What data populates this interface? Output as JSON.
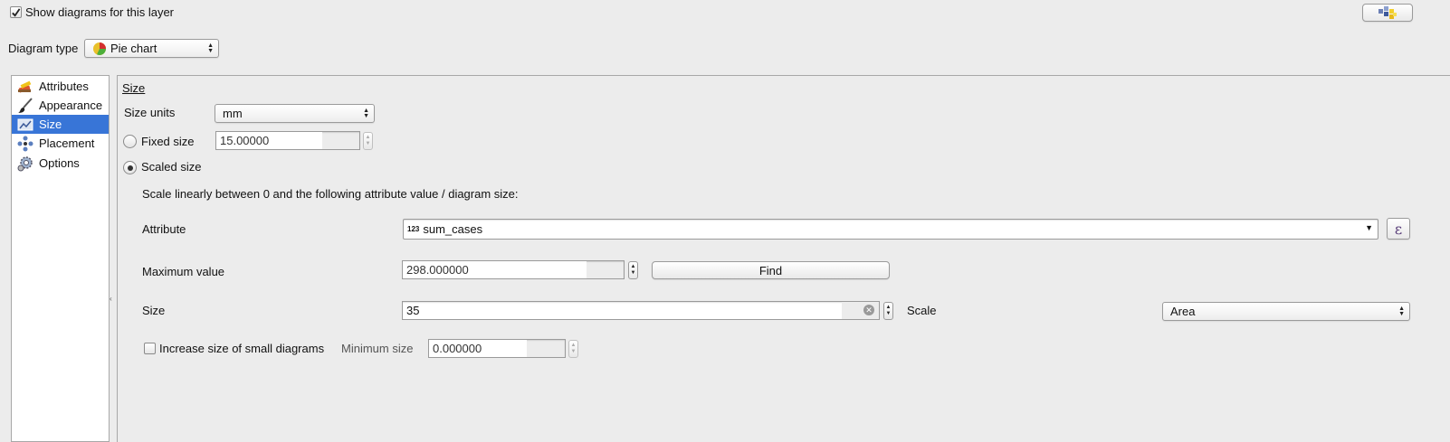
{
  "top": {
    "show_diagrams_label": "Show diagrams for this layer",
    "show_diagrams_checked": true,
    "diagram_type_label": "Diagram type",
    "diagram_type_value": "Pie chart"
  },
  "sidebar": {
    "items": [
      {
        "label": "Attributes",
        "icon": "attributes-icon"
      },
      {
        "label": "Appearance",
        "icon": "brush-icon"
      },
      {
        "label": "Size",
        "icon": "size-icon",
        "selected": true
      },
      {
        "label": "Placement",
        "icon": "placement-icon"
      },
      {
        "label": "Options",
        "icon": "options-gear-icon"
      }
    ]
  },
  "size_section": {
    "heading": "Size",
    "size_units_label": "Size units",
    "size_units_value": "mm",
    "fixed_size_label": "Fixed size",
    "fixed_size_value": "15.00000",
    "scaled_size_label": "Scaled size",
    "scaled_size_selected": true,
    "scale_description": "Scale linearly between 0 and the following attribute value / diagram size:",
    "attribute_label": "Attribute",
    "attribute_type_badge": "123",
    "attribute_value": "sum_cases",
    "expression_button_label": "ε",
    "maximum_value_label": "Maximum value",
    "maximum_value": "298.000000",
    "find_button_label": "Find",
    "size_label": "Size",
    "size_value": "35",
    "scale_label": "Scale",
    "scale_value": "Area",
    "increase_small_label": "Increase size of small diagrams",
    "increase_small_checked": false,
    "minimum_size_label": "Minimum size",
    "minimum_size_value": "0.000000"
  },
  "colors": {
    "selection": "#3875d7",
    "background": "#ececec"
  }
}
